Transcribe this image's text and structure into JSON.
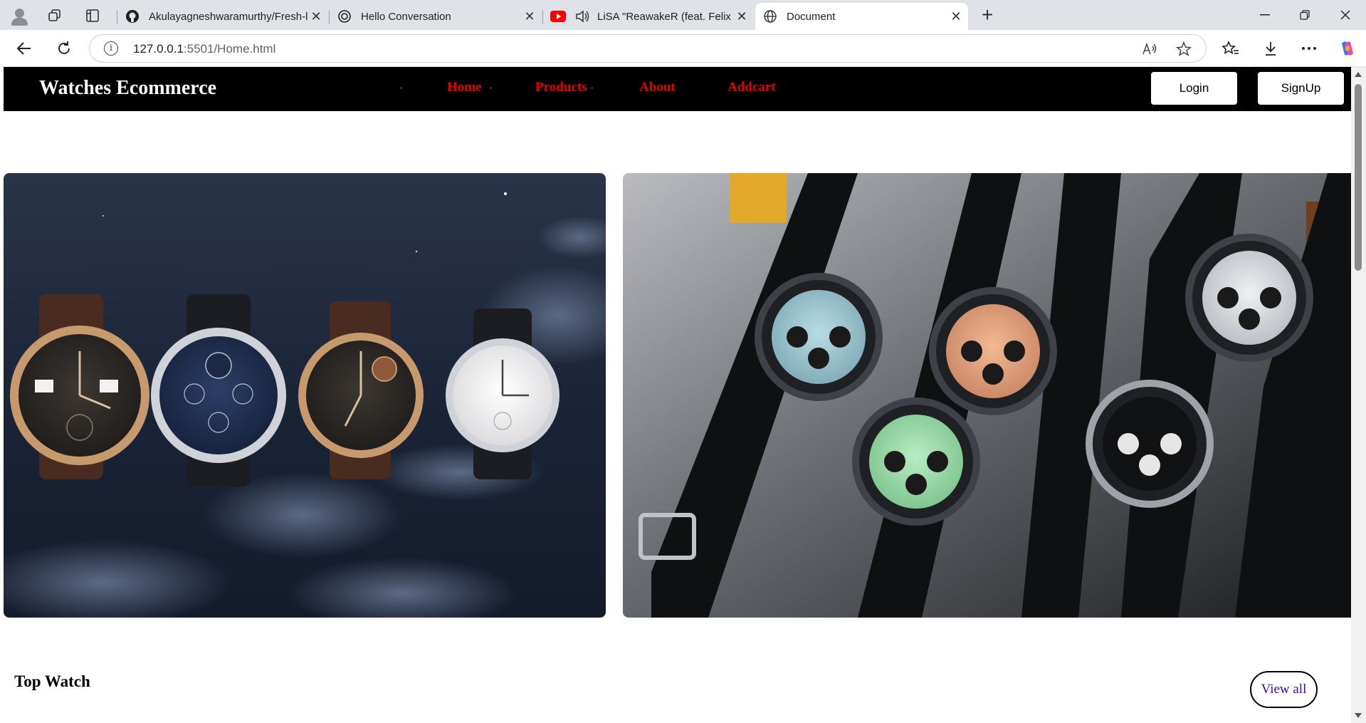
{
  "browser": {
    "tabs": [
      {
        "title": "Akulayagneshwaramurthy/Fresh-l",
        "favicon": "github-icon",
        "active": false
      },
      {
        "title": "Hello Conversation",
        "favicon": "openai-icon",
        "active": false
      },
      {
        "title": "LiSA \"ReawakeR (feat. Felix o",
        "favicon": "youtube-icon",
        "active": false,
        "audio": true
      },
      {
        "title": "Document",
        "favicon": "globe-icon",
        "active": true
      }
    ],
    "url_host": "127.0.0.1",
    "url_rest": ":5501/Home.html"
  },
  "site": {
    "brand": "Watches Ecommerce",
    "nav": [
      "Home",
      "Products",
      "About",
      "Addcart"
    ],
    "login_label": "Login",
    "signup_label": "SignUp"
  },
  "hero": {
    "left_image": "watch-collection-night-sky-image",
    "right_image": "chronograph-watches-leather-straps-image"
  },
  "section": {
    "title": "Top Watch",
    "view_all_label": "View all"
  },
  "colors": {
    "nav_bg": "#000000",
    "nav_link": "#e00000",
    "view_all_text": "#3a0ca3"
  }
}
